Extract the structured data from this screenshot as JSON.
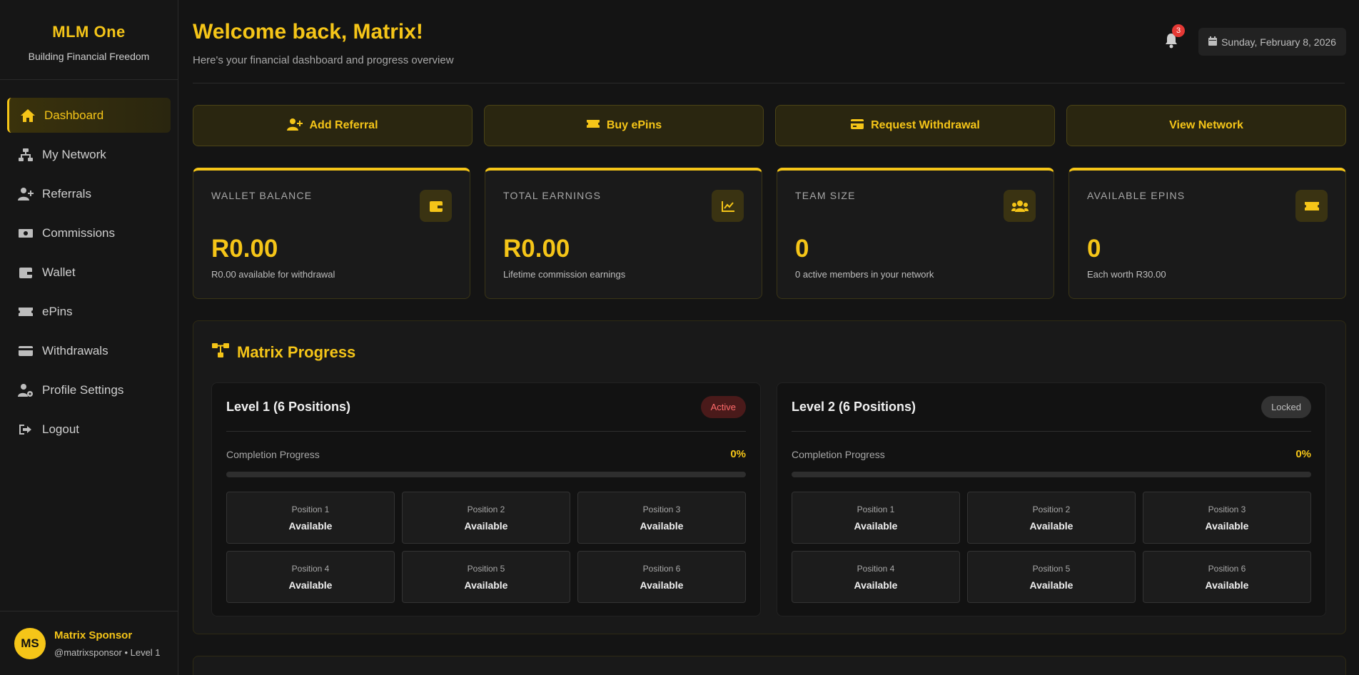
{
  "brand": {
    "name": "MLM One",
    "tagline": "Building Financial Freedom"
  },
  "nav": [
    {
      "label": "Dashboard",
      "icon": "home-icon",
      "active": true
    },
    {
      "label": "My Network",
      "icon": "network-icon",
      "active": false
    },
    {
      "label": "Referrals",
      "icon": "user-plus-icon",
      "active": false
    },
    {
      "label": "Commissions",
      "icon": "money-icon",
      "active": false
    },
    {
      "label": "Wallet",
      "icon": "wallet-icon",
      "active": false
    },
    {
      "label": "ePins",
      "icon": "ticket-icon",
      "active": false
    },
    {
      "label": "Withdrawals",
      "icon": "credit-card-icon",
      "active": false
    },
    {
      "label": "Profile Settings",
      "icon": "user-gear-icon",
      "active": false
    },
    {
      "label": "Logout",
      "icon": "logout-icon",
      "active": false
    }
  ],
  "user": {
    "initials": "MS",
    "name": "Matrix Sponsor",
    "sub": "@matrixsponsor • Level 1"
  },
  "header": {
    "welcome": "Welcome back, Matrix!",
    "subtitle": "Here's your financial dashboard and progress overview",
    "notification_count": "3",
    "date": "Sunday, February 8, 2026"
  },
  "actions": [
    {
      "label": "Add Referral",
      "icon": "user-plus-icon"
    },
    {
      "label": "Buy ePins",
      "icon": "ticket-icon"
    },
    {
      "label": "Request Withdrawal",
      "icon": "credit-card-icon"
    },
    {
      "label": "View Network",
      "icon": ""
    }
  ],
  "stats": [
    {
      "label": "WALLET BALANCE",
      "value": "R0.00",
      "sub": "R0.00 available for withdrawal",
      "icon": "wallet-icon"
    },
    {
      "label": "TOTAL EARNINGS",
      "value": "R0.00",
      "sub": "Lifetime commission earnings",
      "icon": "chart-line-icon"
    },
    {
      "label": "TEAM SIZE",
      "value": "0",
      "sub": "0 active members in your network",
      "icon": "users-icon"
    },
    {
      "label": "AVAILABLE EPINS",
      "value": "0",
      "sub": "Each worth R30.00",
      "icon": "ticket-icon"
    }
  ],
  "matrix": {
    "title": "Matrix Progress",
    "levels": [
      {
        "title": "Level 1 (6 Positions)",
        "badge": "Active",
        "progress_label": "Completion Progress",
        "progress_pct": "0%",
        "progress_value": 0,
        "positions": [
          {
            "name": "Position 1",
            "status": "Available"
          },
          {
            "name": "Position 2",
            "status": "Available"
          },
          {
            "name": "Position 3",
            "status": "Available"
          },
          {
            "name": "Position 4",
            "status": "Available"
          },
          {
            "name": "Position 5",
            "status": "Available"
          },
          {
            "name": "Position 6",
            "status": "Available"
          }
        ]
      },
      {
        "title": "Level 2 (6 Positions)",
        "badge": "Locked",
        "progress_label": "Completion Progress",
        "progress_pct": "0%",
        "progress_value": 0,
        "positions": [
          {
            "name": "Position 1",
            "status": "Available"
          },
          {
            "name": "Position 2",
            "status": "Available"
          },
          {
            "name": "Position 3",
            "status": "Available"
          },
          {
            "name": "Position 4",
            "status": "Available"
          },
          {
            "name": "Position 5",
            "status": "Available"
          },
          {
            "name": "Position 6",
            "status": "Available"
          }
        ]
      }
    ]
  },
  "colors": {
    "accent": "#f5c518",
    "background": "#141414",
    "danger": "#e53935"
  }
}
